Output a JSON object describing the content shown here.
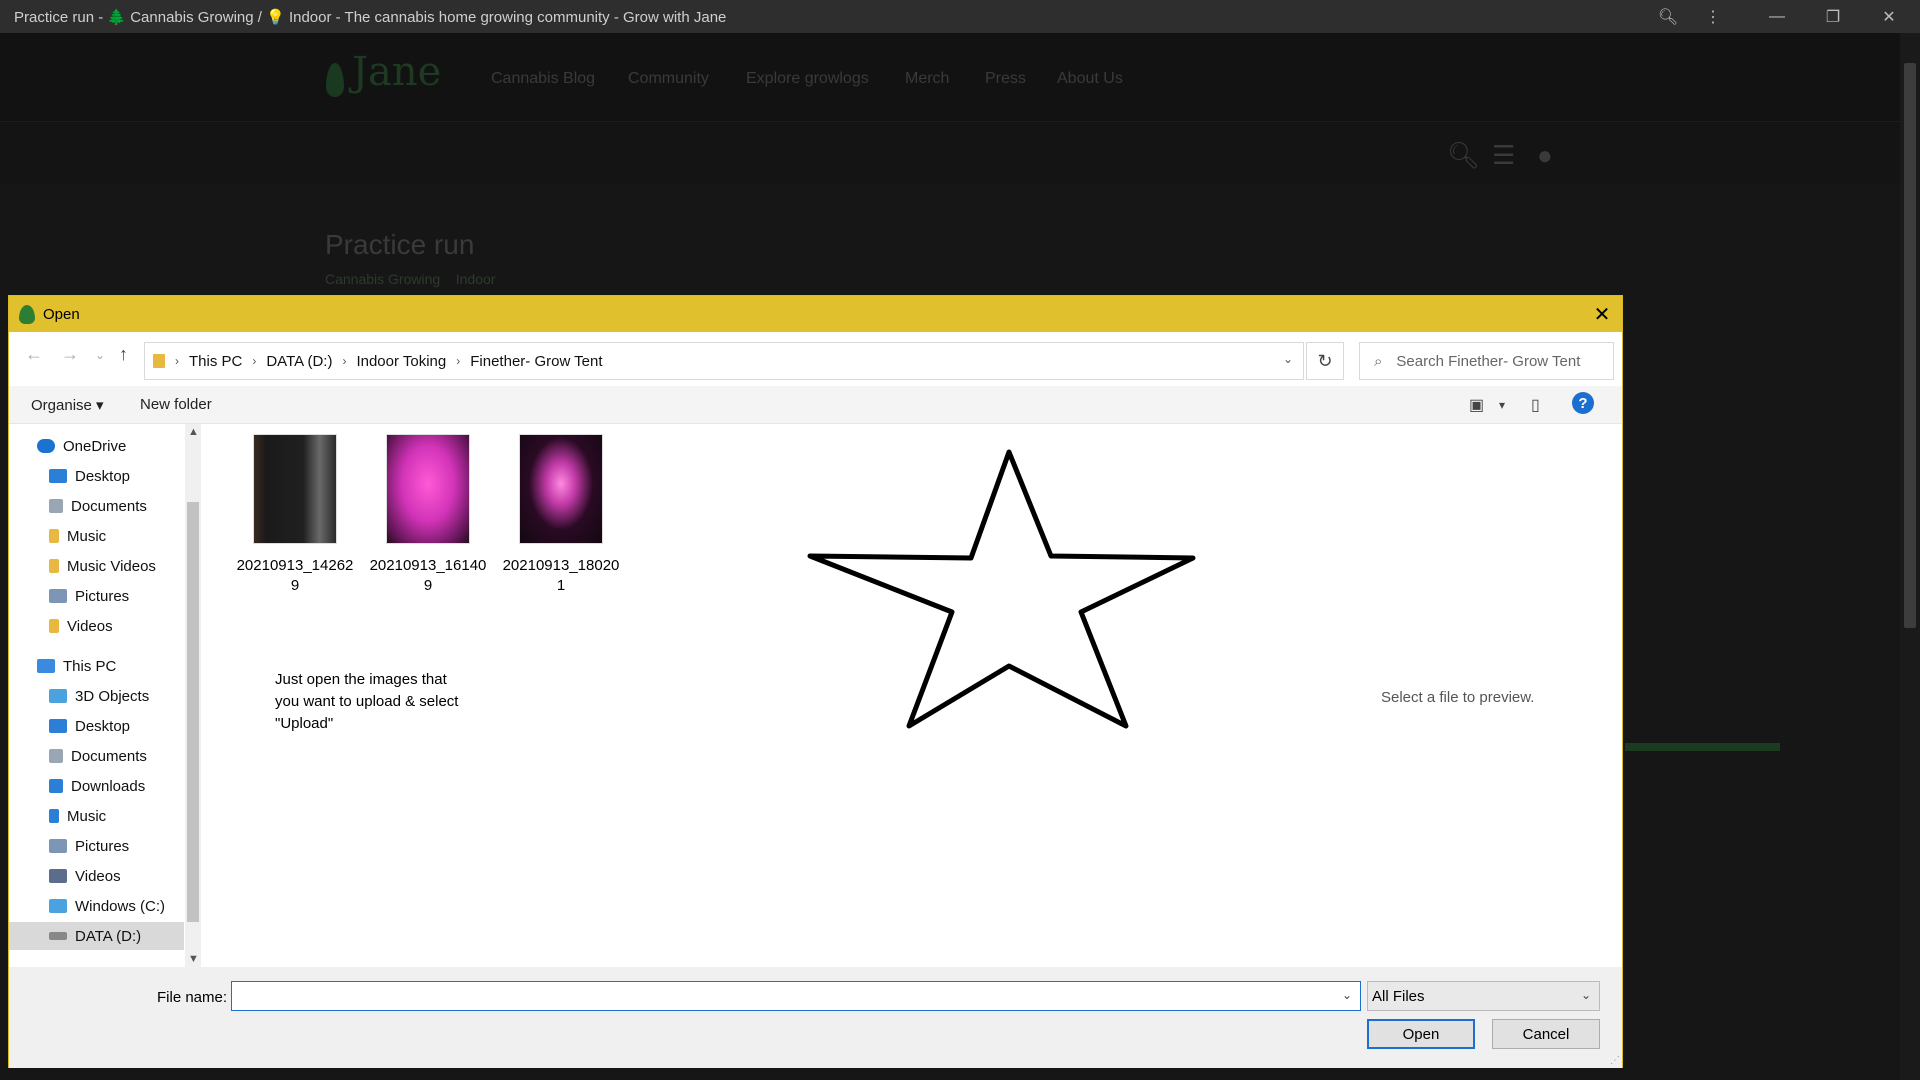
{
  "browser": {
    "title": "Practice run - 🌲 Cannabis Growing / 💡 Indoor - The cannabis home growing community - Grow with Jane"
  },
  "site": {
    "logo": "Jane",
    "nav": [
      "Cannabis Blog",
      "Community",
      "Explore growlogs",
      "Merch",
      "Press",
      "About Us"
    ],
    "page_title": "Practice run",
    "breadcrumbs": [
      "Cannabis Growing",
      "Indoor"
    ]
  },
  "dialog": {
    "title": "Open",
    "path": [
      "This PC",
      "DATA (D:)",
      "Indoor Toking",
      "Finether- Grow Tent"
    ],
    "search_placeholder": "Search Finether- Grow Tent",
    "toolbar": {
      "organise": "Organise",
      "new_folder": "New folder",
      "help": "?"
    },
    "nav": {
      "quick": [
        {
          "label": "OneDrive",
          "icon": "onedrive-icon",
          "color": "#1a73d0"
        },
        {
          "label": "Desktop",
          "icon": "desktop-icon",
          "color": "#2b7fd6"
        },
        {
          "label": "Documents",
          "icon": "documents-icon",
          "color": "#9aa6b4"
        },
        {
          "label": "Music",
          "icon": "folder-icon",
          "color": "#e8b940"
        },
        {
          "label": "Music Videos",
          "icon": "folder-icon",
          "color": "#e8b940"
        },
        {
          "label": "Pictures",
          "icon": "pictures-icon",
          "color": "#7d96b6"
        },
        {
          "label": "Videos",
          "icon": "folder-icon",
          "color": "#e8b940"
        }
      ],
      "this_pc": {
        "label": "This PC",
        "icon": "computer-icon",
        "color": "#3a8ae0"
      },
      "pc_items": [
        {
          "label": "3D Objects",
          "icon": "3d-objects-icon",
          "color": "#4aa3df"
        },
        {
          "label": "Desktop",
          "icon": "desktop-icon",
          "color": "#2b7fd6"
        },
        {
          "label": "Documents",
          "icon": "documents-icon",
          "color": "#9aa6b4"
        },
        {
          "label": "Downloads",
          "icon": "downloads-icon",
          "color": "#2b7fd6"
        },
        {
          "label": "Music",
          "icon": "music-icon",
          "color": "#2b7fd6"
        },
        {
          "label": "Pictures",
          "icon": "pictures-icon",
          "color": "#7d96b6"
        },
        {
          "label": "Videos",
          "icon": "videos-icon",
          "color": "#5b6d8a"
        },
        {
          "label": "Windows (C:)",
          "icon": "drive-icon",
          "color": "#4aa3df"
        },
        {
          "label": "DATA (D:)",
          "icon": "drive-icon",
          "color": "#888888"
        }
      ]
    },
    "files": [
      {
        "name": "20210913_142629",
        "thumb": "tent-photo-dark"
      },
      {
        "name": "20210913_161409",
        "thumb": "tent-photo-pink"
      },
      {
        "name": "20210913_180201",
        "thumb": "tent-photo-pink-dark"
      }
    ],
    "annotation": "Just open the images that you want to upload & select \"Upload\"",
    "preview_text": "Select a file to preview.",
    "footer": {
      "file_name_label": "File name:",
      "file_name_value": "",
      "file_type": "All Files",
      "open": "Open",
      "cancel": "Cancel"
    }
  }
}
